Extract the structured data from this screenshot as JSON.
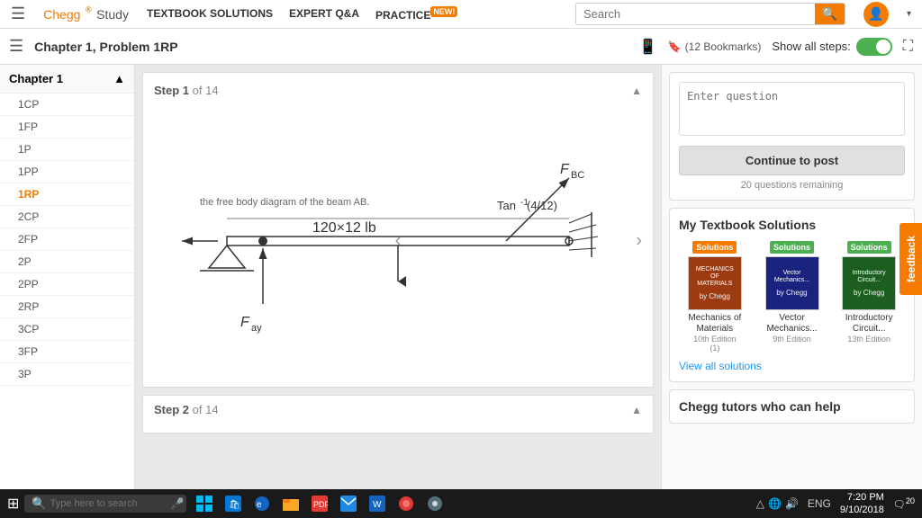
{
  "nav": {
    "logo_chegg": "Chegg",
    "logo_study": "Study",
    "hamburger": "☰",
    "links": [
      {
        "label": "TEXTBOOK SOLUTIONS",
        "id": "textbook-solutions"
      },
      {
        "label": "EXPERT Q&A",
        "id": "expert-qa"
      },
      {
        "label": "PRACTICE",
        "id": "practice",
        "badge": "NEW!"
      }
    ],
    "search_placeholder": "Search",
    "search_icon": "🔍",
    "user_icon": "👤",
    "chevron": "▾"
  },
  "problem_bar": {
    "list_icon": "☰",
    "title": "Chapter 1, Problem 1RP",
    "mobile_icon": "📱",
    "bookmark_label": "(12 Bookmarks)",
    "bookmark_icon": "🔖",
    "show_steps_label": "Show all steps:",
    "toggle_label": "ON",
    "expand_icon": "⛶"
  },
  "sidebar": {
    "chapter_label": "Chapter 1",
    "chevron_up": "▲",
    "items": [
      {
        "label": "1CP",
        "active": false
      },
      {
        "label": "1FP",
        "active": false
      },
      {
        "label": "1P",
        "active": false
      },
      {
        "label": "1PP",
        "active": false
      },
      {
        "label": "1RP",
        "active": true
      },
      {
        "label": "2CP",
        "active": false
      },
      {
        "label": "2FP",
        "active": false
      },
      {
        "label": "2P",
        "active": false
      },
      {
        "label": "2PP",
        "active": false
      },
      {
        "label": "2RP",
        "active": false
      },
      {
        "label": "3CP",
        "active": false
      },
      {
        "label": "3FP",
        "active": false
      },
      {
        "label": "3P",
        "active": false
      }
    ]
  },
  "step1": {
    "label": "Step 1",
    "of_label": "of 14",
    "chevron": "▲",
    "description": "the free body diagram of the beam AB."
  },
  "step2": {
    "label": "Step 2",
    "of_label": "of 14",
    "chevron": "▲"
  },
  "right_panel": {
    "ask_placeholder": "Enter question",
    "continue_label": "Continue to post",
    "questions_remaining": "20 questions remaining",
    "my_solutions_title": "My Textbook Solutions",
    "solutions": [
      {
        "badge": "Solutions",
        "badge_color": "badge-orange",
        "name": "Mechanics of Materials",
        "edition": "10th Edition",
        "rating": "(1)"
      },
      {
        "badge": "Solutions",
        "badge_color": "badge-green",
        "name": "Vector Mechanics...",
        "edition": "9th Edition",
        "rating": ""
      },
      {
        "badge": "Solutions",
        "badge_color": "badge-green",
        "name": "Introductory Circuit...",
        "edition": "13th Edition",
        "rating": ""
      }
    ],
    "view_all_label": "View all solutions",
    "tutors_title": "Chegg tutors who can help"
  },
  "feedback": {
    "label": "feedback"
  },
  "taskbar": {
    "start_icon": "⊞",
    "search_placeholder": "Type here to search",
    "mic_icon": "🎤",
    "time": "7:20 PM",
    "date": "9/10/2018",
    "notification_count": "20",
    "lang": "ENG"
  }
}
